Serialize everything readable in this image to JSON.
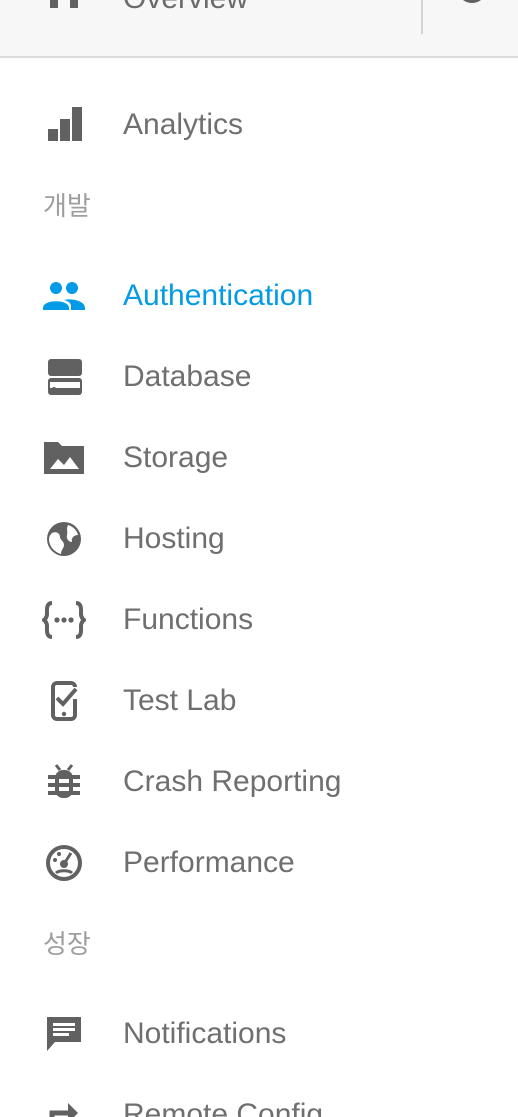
{
  "topbar": {
    "overview_label": "Overview",
    "home_icon": "home-icon",
    "settings_icon": "gear-icon"
  },
  "nav": {
    "analytics": {
      "label": "Analytics",
      "icon": "bar-chart-icon"
    },
    "section_develop": "개발",
    "develop_items": [
      {
        "label": "Authentication",
        "icon": "people-icon",
        "active": true
      },
      {
        "label": "Database",
        "icon": "database-icon",
        "active": false
      },
      {
        "label": "Storage",
        "icon": "folder-image-icon",
        "active": false
      },
      {
        "label": "Hosting",
        "icon": "globe-icon",
        "active": false
      },
      {
        "label": "Functions",
        "icon": "functions-icon",
        "active": false
      },
      {
        "label": "Test Lab",
        "icon": "device-check-icon",
        "active": false
      },
      {
        "label": "Crash Reporting",
        "icon": "bug-icon",
        "active": false
      },
      {
        "label": "Performance",
        "icon": "speedometer-icon",
        "active": false
      }
    ],
    "section_grow": "성장",
    "grow_items": [
      {
        "label": "Notifications",
        "icon": "message-icon",
        "active": false
      },
      {
        "label": "Remote Config",
        "icon": "forward-arrow-icon",
        "active": false
      }
    ]
  },
  "colors": {
    "active": "#039be5",
    "icon": "#616161",
    "text": "#6f6f6f",
    "section": "#9e9e9e"
  }
}
